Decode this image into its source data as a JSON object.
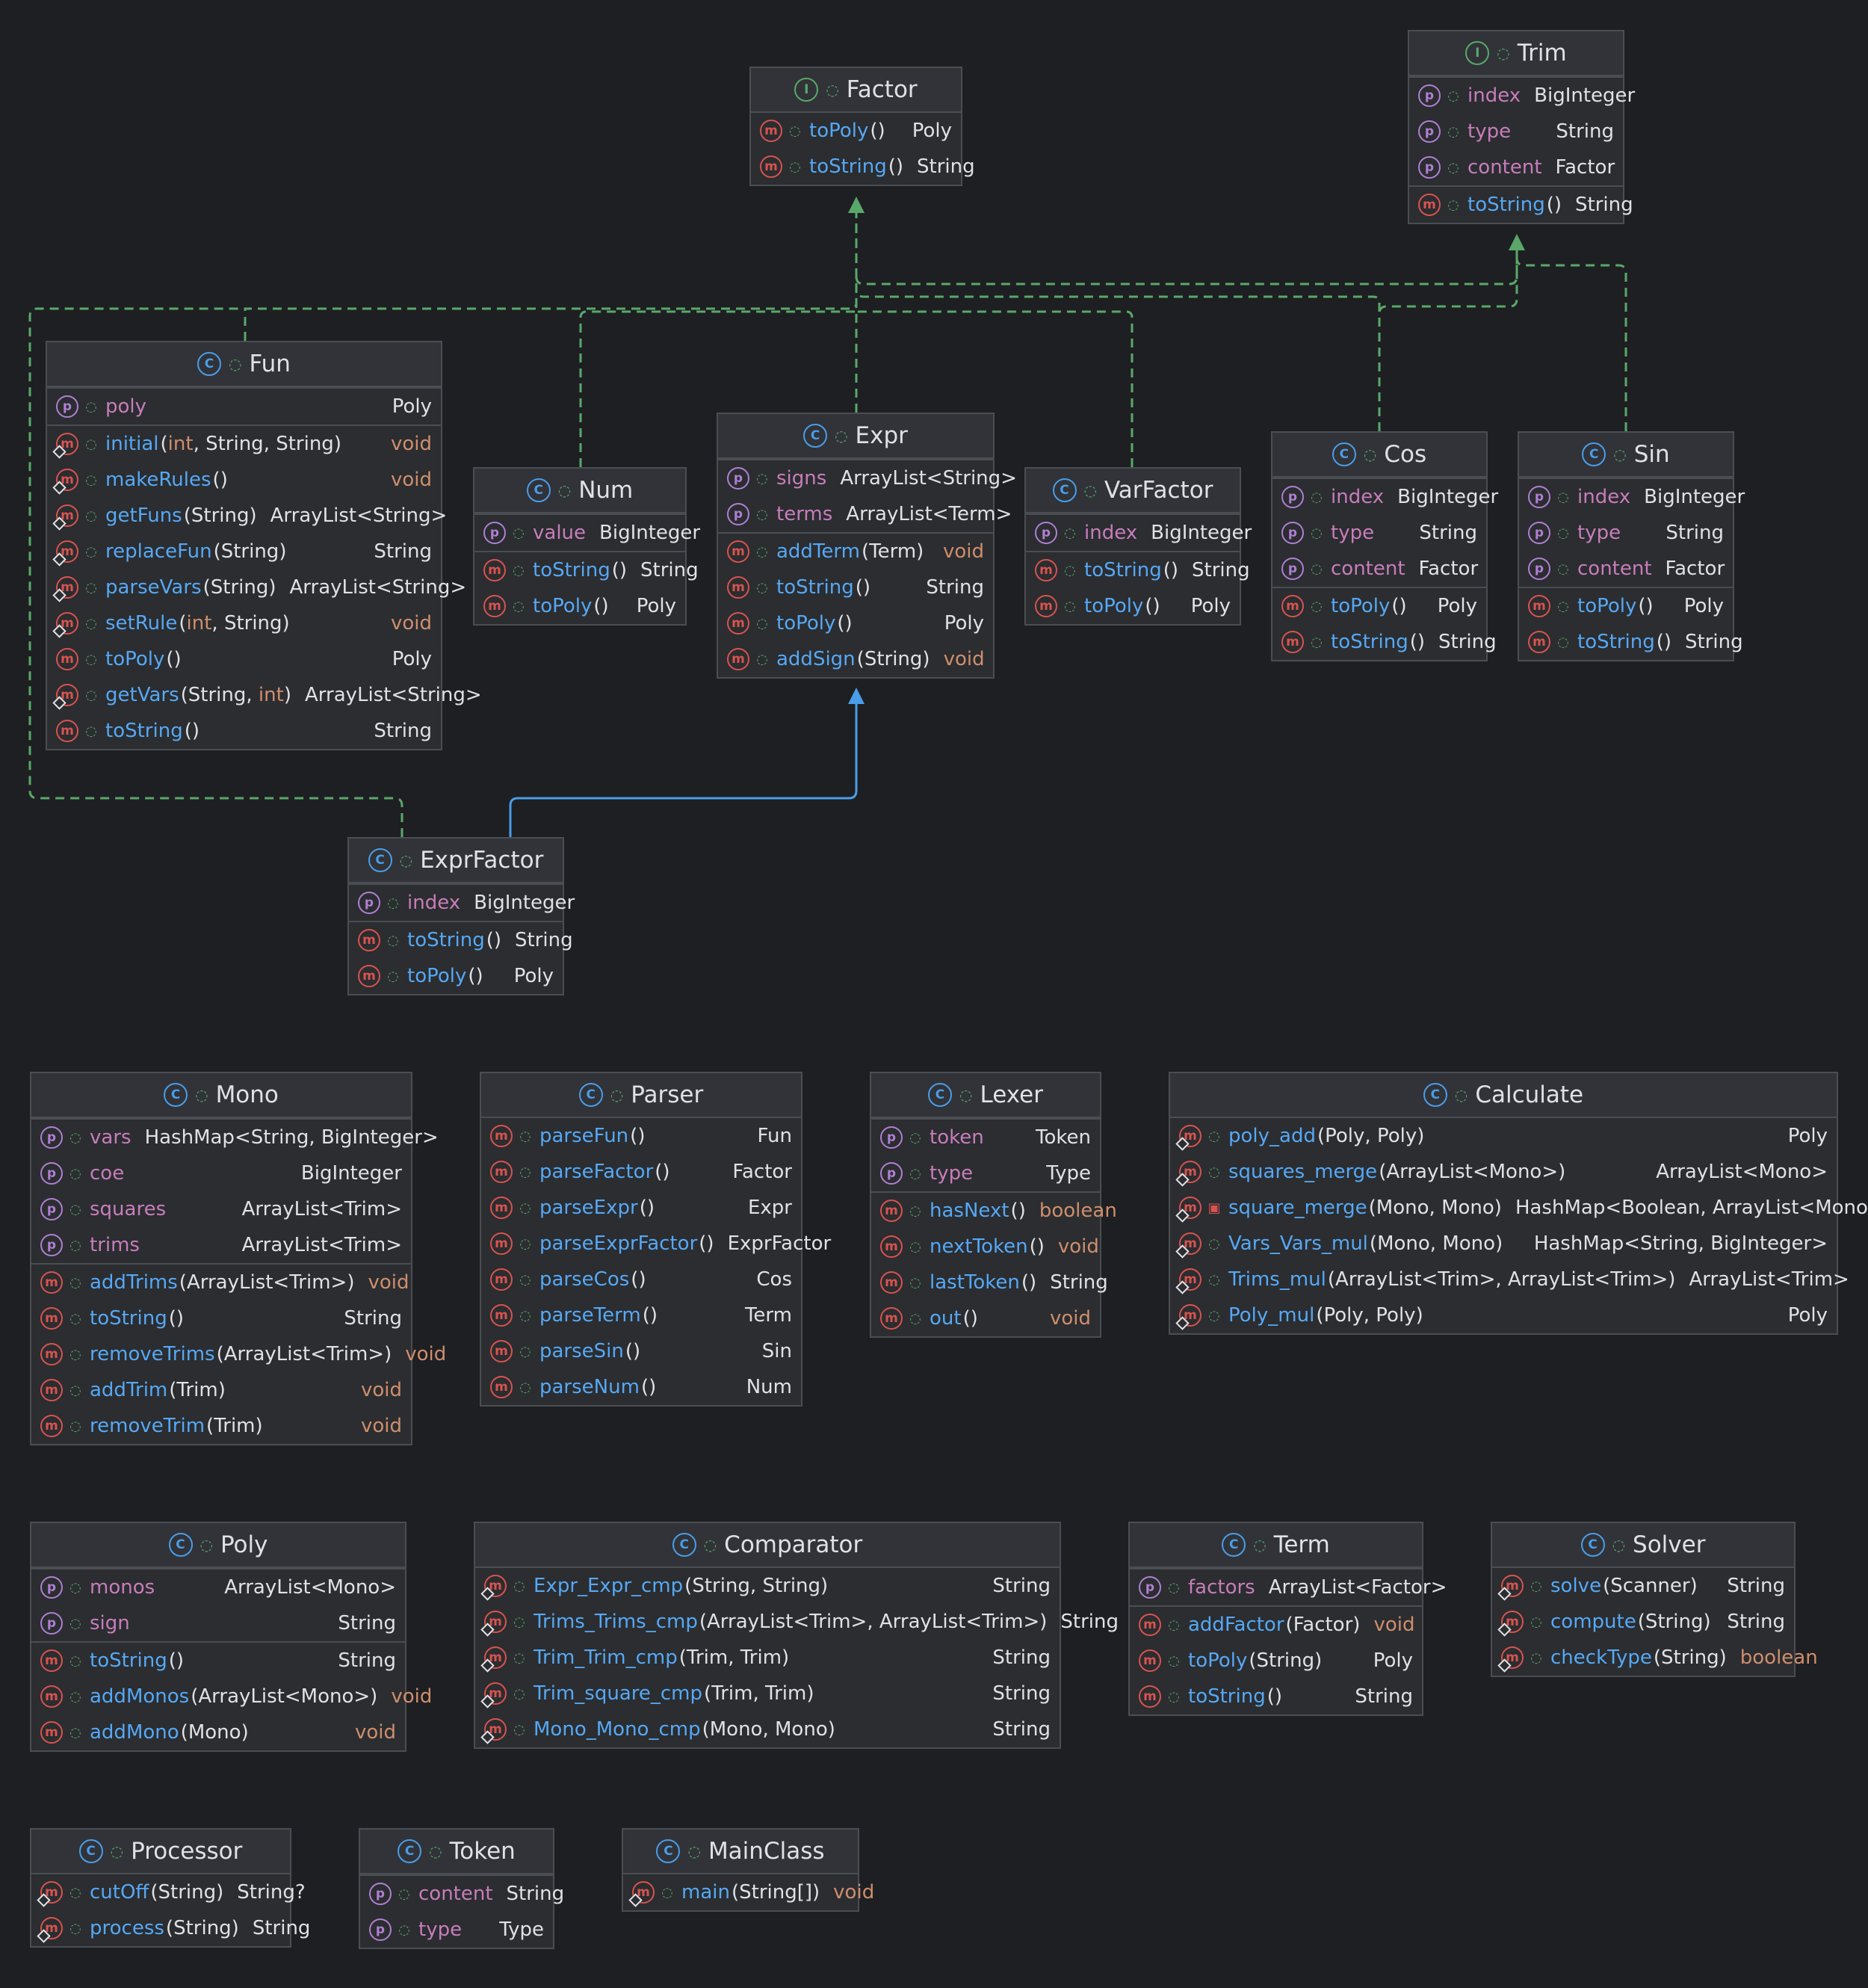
{
  "colors": {
    "background": "#1e1f22",
    "panel": "#2b2d30",
    "border": "#4a4d52",
    "field_name": "#c77dbb",
    "method_name": "#56a8f5",
    "primitive": "#cf8e6d",
    "implements_edge": "#59a869",
    "extends_edge": "#4a9de8"
  },
  "classes": [
    {
      "name": "Factor",
      "kind": "interface",
      "fields": [],
      "methods": [
        {
          "name": "toPoly",
          "params": [],
          "ret": "Poly"
        },
        {
          "name": "toString",
          "params": [],
          "ret": "String"
        }
      ]
    },
    {
      "name": "Trim",
      "kind": "interface",
      "fields": [
        {
          "name": "index",
          "type": "BigInteger"
        },
        {
          "name": "type",
          "type": "String"
        },
        {
          "name": "content",
          "type": "Factor"
        }
      ],
      "methods": [
        {
          "name": "toString",
          "params": [],
          "ret": "String"
        }
      ]
    },
    {
      "name": "Fun",
      "kind": "class",
      "fields": [
        {
          "name": "poly",
          "type": "Poly"
        }
      ],
      "methods": [
        {
          "name": "initial",
          "params": [
            "int",
            "String",
            "String"
          ],
          "ret": "void",
          "static": true
        },
        {
          "name": "makeRules",
          "params": [],
          "ret": "void",
          "static": true
        },
        {
          "name": "getFuns",
          "params": [
            "String"
          ],
          "ret": "ArrayList<String>",
          "static": true
        },
        {
          "name": "replaceFun",
          "params": [
            "String"
          ],
          "ret": "String",
          "static": true
        },
        {
          "name": "parseVars",
          "params": [
            "String"
          ],
          "ret": "ArrayList<String>",
          "static": true
        },
        {
          "name": "setRule",
          "params": [
            "int",
            "String"
          ],
          "ret": "void",
          "static": true
        },
        {
          "name": "toPoly",
          "params": [],
          "ret": "Poly"
        },
        {
          "name": "getVars",
          "params": [
            "String",
            "int"
          ],
          "ret": "ArrayList<String>",
          "static": true
        },
        {
          "name": "toString",
          "params": [],
          "ret": "String"
        }
      ]
    },
    {
      "name": "Num",
      "kind": "class",
      "fields": [
        {
          "name": "value",
          "type": "BigInteger"
        }
      ],
      "methods": [
        {
          "name": "toString",
          "params": [],
          "ret": "String"
        },
        {
          "name": "toPoly",
          "params": [],
          "ret": "Poly"
        }
      ]
    },
    {
      "name": "Expr",
      "kind": "class",
      "fields": [
        {
          "name": "signs",
          "type": "ArrayList<String>"
        },
        {
          "name": "terms",
          "type": "ArrayList<Term>"
        }
      ],
      "methods": [
        {
          "name": "addTerm",
          "params": [
            "Term"
          ],
          "ret": "void"
        },
        {
          "name": "toString",
          "params": [],
          "ret": "String"
        },
        {
          "name": "toPoly",
          "params": [],
          "ret": "Poly"
        },
        {
          "name": "addSign",
          "params": [
            "String"
          ],
          "ret": "void"
        }
      ]
    },
    {
      "name": "VarFactor",
      "kind": "class",
      "fields": [
        {
          "name": "index",
          "type": "BigInteger"
        }
      ],
      "methods": [
        {
          "name": "toString",
          "params": [],
          "ret": "String"
        },
        {
          "name": "toPoly",
          "params": [],
          "ret": "Poly"
        }
      ]
    },
    {
      "name": "Cos",
      "kind": "class",
      "fields": [
        {
          "name": "index",
          "type": "BigInteger"
        },
        {
          "name": "type",
          "type": "String"
        },
        {
          "name": "content",
          "type": "Factor"
        }
      ],
      "methods": [
        {
          "name": "toPoly",
          "params": [],
          "ret": "Poly"
        },
        {
          "name": "toString",
          "params": [],
          "ret": "String"
        }
      ]
    },
    {
      "name": "Sin",
      "kind": "class",
      "fields": [
        {
          "name": "index",
          "type": "BigInteger"
        },
        {
          "name": "type",
          "type": "String"
        },
        {
          "name": "content",
          "type": "Factor"
        }
      ],
      "methods": [
        {
          "name": "toPoly",
          "params": [],
          "ret": "Poly"
        },
        {
          "name": "toString",
          "params": [],
          "ret": "String"
        }
      ]
    },
    {
      "name": "ExprFactor",
      "kind": "class",
      "fields": [
        {
          "name": "index",
          "type": "BigInteger"
        }
      ],
      "methods": [
        {
          "name": "toString",
          "params": [],
          "ret": "String"
        },
        {
          "name": "toPoly",
          "params": [],
          "ret": "Poly"
        }
      ]
    },
    {
      "name": "Mono",
      "kind": "class",
      "fields": [
        {
          "name": "vars",
          "type": "HashMap<String, BigInteger>"
        },
        {
          "name": "coe",
          "type": "BigInteger"
        },
        {
          "name": "squares",
          "type": "ArrayList<Trim>"
        },
        {
          "name": "trims",
          "type": "ArrayList<Trim>"
        }
      ],
      "methods": [
        {
          "name": "addTrims",
          "params": [
            "ArrayList<Trim>"
          ],
          "ret": "void"
        },
        {
          "name": "toString",
          "params": [],
          "ret": "String"
        },
        {
          "name": "removeTrims",
          "params": [
            "ArrayList<Trim>"
          ],
          "ret": "void"
        },
        {
          "name": "addTrim",
          "params": [
            "Trim"
          ],
          "ret": "void"
        },
        {
          "name": "removeTrim",
          "params": [
            "Trim"
          ],
          "ret": "void"
        }
      ]
    },
    {
      "name": "Parser",
      "kind": "class",
      "fields": [],
      "methods": [
        {
          "name": "parseFun",
          "params": [],
          "ret": "Fun"
        },
        {
          "name": "parseFactor",
          "params": [],
          "ret": "Factor"
        },
        {
          "name": "parseExpr",
          "params": [],
          "ret": "Expr"
        },
        {
          "name": "parseExprFactor",
          "params": [],
          "ret": "ExprFactor"
        },
        {
          "name": "parseCos",
          "params": [],
          "ret": "Cos"
        },
        {
          "name": "parseTerm",
          "params": [],
          "ret": "Term"
        },
        {
          "name": "parseSin",
          "params": [],
          "ret": "Sin"
        },
        {
          "name": "parseNum",
          "params": [],
          "ret": "Num"
        }
      ]
    },
    {
      "name": "Lexer",
      "kind": "class",
      "fields": [
        {
          "name": "token",
          "type": "Token"
        },
        {
          "name": "type",
          "type": "Type"
        }
      ],
      "methods": [
        {
          "name": "hasNext",
          "params": [],
          "ret": "boolean"
        },
        {
          "name": "nextToken",
          "params": [],
          "ret": "void"
        },
        {
          "name": "lastToken",
          "params": [],
          "ret": "String"
        },
        {
          "name": "out",
          "params": [],
          "ret": "void"
        }
      ]
    },
    {
      "name": "Calculate",
      "kind": "class",
      "fields": [],
      "methods": [
        {
          "name": "poly_add",
          "params": [
            "Poly",
            "Poly"
          ],
          "ret": "Poly",
          "static": true
        },
        {
          "name": "squares_merge",
          "params": [
            "ArrayList<Mono>"
          ],
          "ret": "ArrayList<Mono>",
          "static": true
        },
        {
          "name": "square_merge",
          "params": [
            "Mono",
            "Mono"
          ],
          "ret": "HashMap<Boolean, ArrayList<Mono>>",
          "static": true,
          "private": true
        },
        {
          "name": "Vars_Vars_mul",
          "params": [
            "Mono",
            "Mono"
          ],
          "ret": "HashMap<String, BigInteger>",
          "static": true
        },
        {
          "name": "Trims_mul",
          "params": [
            "ArrayList<Trim>",
            "ArrayList<Trim>"
          ],
          "ret": "ArrayList<Trim>",
          "static": true
        },
        {
          "name": "Poly_mul",
          "params": [
            "Poly",
            "Poly"
          ],
          "ret": "Poly",
          "static": true
        }
      ]
    },
    {
      "name": "Poly",
      "kind": "class",
      "fields": [
        {
          "name": "monos",
          "type": "ArrayList<Mono>"
        },
        {
          "name": "sign",
          "type": "String"
        }
      ],
      "methods": [
        {
          "name": "toString",
          "params": [],
          "ret": "String"
        },
        {
          "name": "addMonos",
          "params": [
            "ArrayList<Mono>"
          ],
          "ret": "void"
        },
        {
          "name": "addMono",
          "params": [
            "Mono"
          ],
          "ret": "void"
        }
      ]
    },
    {
      "name": "Comparator",
      "kind": "class",
      "fields": [],
      "methods": [
        {
          "name": "Expr_Expr_cmp",
          "params": [
            "String",
            "String"
          ],
          "ret": "String",
          "static": true
        },
        {
          "name": "Trims_Trims_cmp",
          "params": [
            "ArrayList<Trim>",
            "ArrayList<Trim>"
          ],
          "ret": "String",
          "static": true
        },
        {
          "name": "Trim_Trim_cmp",
          "params": [
            "Trim",
            "Trim"
          ],
          "ret": "String",
          "static": true
        },
        {
          "name": "Trim_square_cmp",
          "params": [
            "Trim",
            "Trim"
          ],
          "ret": "String",
          "static": true
        },
        {
          "name": "Mono_Mono_cmp",
          "params": [
            "Mono",
            "Mono"
          ],
          "ret": "String",
          "static": true
        }
      ]
    },
    {
      "name": "Term",
      "kind": "class",
      "fields": [
        {
          "name": "factors",
          "type": "ArrayList<Factor>"
        }
      ],
      "methods": [
        {
          "name": "addFactor",
          "params": [
            "Factor"
          ],
          "ret": "void"
        },
        {
          "name": "toPoly",
          "params": [
            "String"
          ],
          "ret": "Poly"
        },
        {
          "name": "toString",
          "params": [],
          "ret": "String"
        }
      ]
    },
    {
      "name": "Solver",
      "kind": "class",
      "fields": [],
      "methods": [
        {
          "name": "solve",
          "params": [
            "Scanner"
          ],
          "ret": "String",
          "static": true
        },
        {
          "name": "compute",
          "params": [
            "String"
          ],
          "ret": "String",
          "static": true
        },
        {
          "name": "checkType",
          "params": [
            "String"
          ],
          "ret": "boolean",
          "static": true
        }
      ]
    },
    {
      "name": "Processor",
      "kind": "class",
      "fields": [],
      "methods": [
        {
          "name": "cutOff",
          "params": [
            "String"
          ],
          "ret": "String?",
          "static": true
        },
        {
          "name": "process",
          "params": [
            "String"
          ],
          "ret": "String",
          "static": true
        }
      ]
    },
    {
      "name": "Token",
      "kind": "class",
      "fields": [
        {
          "name": "content",
          "type": "String"
        },
        {
          "name": "type",
          "type": "Type"
        }
      ],
      "methods": []
    },
    {
      "name": "MainClass",
      "kind": "class",
      "fields": [],
      "methods": [
        {
          "name": "main",
          "params": [
            "String[]"
          ],
          "ret": "void",
          "static": true
        }
      ]
    }
  ],
  "relations": [
    {
      "from": "Fun",
      "to": "Factor",
      "type": "implements"
    },
    {
      "from": "Num",
      "to": "Factor",
      "type": "implements"
    },
    {
      "from": "Expr",
      "to": "Factor",
      "type": "implements"
    },
    {
      "from": "VarFactor",
      "to": "Factor",
      "type": "implements"
    },
    {
      "from": "Cos",
      "to": "Factor",
      "type": "implements"
    },
    {
      "from": "ExprFactor",
      "to": "Factor",
      "type": "implements"
    },
    {
      "from": "Cos",
      "to": "Trim",
      "type": "implements"
    },
    {
      "from": "Sin",
      "to": "Trim",
      "type": "implements"
    },
    {
      "from": "ExprFactor",
      "to": "Expr",
      "type": "extends"
    }
  ]
}
